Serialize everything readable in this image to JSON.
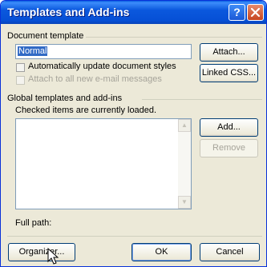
{
  "window": {
    "title": "Templates and Add-ins",
    "title_bar_color": "#0650d6"
  },
  "titlebar_buttons": {
    "help": "?",
    "close": "close-icon"
  },
  "document_template": {
    "section_label": "Document template",
    "template_value": "Normal",
    "attach_button": "Attach...",
    "auto_update_label": "Automatically update document styles",
    "auto_update_checked": false,
    "attach_email_label": "Attach to all new e-mail messages",
    "attach_email_checked": false,
    "linked_css_button": "Linked CSS..."
  },
  "global": {
    "section_label": "Global templates and add-ins",
    "hint": "Checked items are currently loaded.",
    "items": [],
    "add_button": "Add...",
    "remove_button": "Remove"
  },
  "full_path": {
    "label": "Full path:",
    "value": ""
  },
  "footer": {
    "organizer_button": "Organizer...",
    "ok_button": "OK",
    "cancel_button": "Cancel"
  }
}
